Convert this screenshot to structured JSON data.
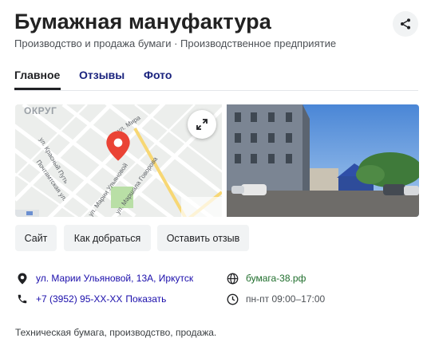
{
  "header": {
    "title": "Бумажная мануфактура",
    "subtitle": "Производство и продажа бумаги · Производственное предприятие",
    "share_icon": "share-icon"
  },
  "tabs": [
    {
      "label": "Главное",
      "active": true
    },
    {
      "label": "Отзывы",
      "active": false
    },
    {
      "label": "Фото",
      "active": false
    }
  ],
  "map": {
    "district_label": "ОКРУГ",
    "streets": {
      "mira": "ул. Мира",
      "krasny_put": "ул. Красный Путь",
      "pochtamtskaya": "Почтамтская ул.",
      "marii_ulyanovoy": "ул. Марии Ульяновой",
      "marshala_govorova": "ул. Маршала Говорова"
    },
    "pin_color": "#ea4335"
  },
  "actions": {
    "site": "Сайт",
    "route": "Как добраться",
    "review": "Оставить отзыв"
  },
  "info": {
    "address": "ул. Марии Ульяновой, 13А, Иркутск",
    "phone": "+7 (3952) 95-ХХ-ХХ",
    "phone_show": "Показать",
    "website": "бумага-38.рф",
    "hours": "пн-пт 09:00–17:00"
  },
  "description": "Техническая бумага, производство, продажа."
}
